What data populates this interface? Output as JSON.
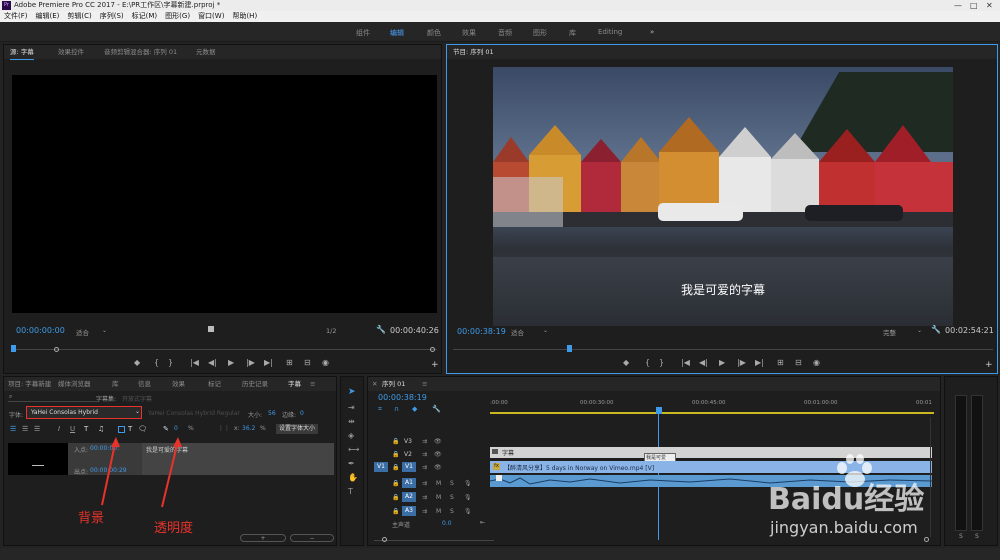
{
  "window": {
    "title": "Adobe Premiere Pro CC 2017 - E:\\PR工作区\\字幕新建.prproj *",
    "minimize": "—",
    "maximize": "□",
    "close": "✕",
    "app_badge": "Pr"
  },
  "menu": [
    "文件(F)",
    "编辑(E)",
    "剪辑(C)",
    "序列(S)",
    "标记(M)",
    "图形(G)",
    "窗口(W)",
    "帮助(H)"
  ],
  "workspaces": [
    "组件",
    "编辑",
    "颜色",
    "效果",
    "音频",
    "图形",
    "库",
    "Editing"
  ],
  "workspaces_more": "»",
  "source_panel": {
    "tabs": [
      "源: 字幕",
      "效果控件",
      "音频剪辑混合器: 序列 01",
      "元数据"
    ],
    "timecode_in": "00:00:00:00",
    "fit": "适合",
    "resolution": "1/2",
    "timecode_out": "00:00:40:26"
  },
  "program_panel": {
    "tab": "节目: 序列 01",
    "subtitle": "我是可爱的字幕",
    "timecode_in": "00:00:38:19",
    "fit": "适合",
    "quality": "完整",
    "timecode_out": "00:02:54:21"
  },
  "transport_source": [
    "◆",
    "{",
    "}",
    "|◀",
    "◀|",
    "▶",
    "|▶",
    "▶|",
    "⊞",
    "⊟",
    "◉"
  ],
  "transport_program": [
    "◆",
    "{",
    "}",
    "|◀",
    "◀|",
    "▶",
    "|▶",
    "▶|",
    "⊞",
    "⊟",
    "◉"
  ],
  "title_panel": {
    "tabs": [
      "项目: 字幕新建",
      "媒体浏览器",
      "库",
      "信息",
      "效果",
      "标记",
      "历史记录",
      "字幕"
    ],
    "search_placeholder": "",
    "title_name_label": "字幕集:",
    "title_name_value": "开放式字幕",
    "font_label": "字体:",
    "font_value": "YaHei Consolas Hybrid",
    "font_style": "YaHei Consolas Hybrid Regular",
    "size_label": "大小:",
    "size_value": "56",
    "edge_label": "边缘:",
    "edge_value": "0",
    "x_label": "x:",
    "x_value": "36.2",
    "x_unit": "%",
    "opacity_unit": "%",
    "set_font_size": "设置字体大小",
    "in_label": "入点:",
    "in_value": "00:00:00:",
    "out_label": "出点:",
    "out_value": "00:00:00:29",
    "caption_text": "我是可爱的字幕",
    "btn_plus": "+",
    "btn_minus": "−"
  },
  "annotations": {
    "background": "背景",
    "opacity": "透明度"
  },
  "timeline": {
    "tab": "序列 01",
    "timecode": "00:00:38:19",
    "ruler": [
      ":00:00",
      "00:00:30:00",
      "00:00:45:00",
      "00:01:00:00",
      "00:01"
    ],
    "tracks": [
      {
        "id": "V3",
        "target": ""
      },
      {
        "id": "V2",
        "target": ""
      },
      {
        "id": "V1",
        "target": "V1"
      },
      {
        "id": "A1",
        "target": ""
      },
      {
        "id": "A2",
        "target": ""
      },
      {
        "id": "A3",
        "target": ""
      }
    ],
    "master_label": "主声道",
    "master_value": "0.0",
    "caption_clip": "字幕",
    "caption_marker": "我是可爱",
    "video_clip": "【醉清风分享】5 days in Norway on Vimeo.mp4 [V]",
    "track_m": "M",
    "track_s": "S"
  },
  "meter": {
    "labels": [
      "S",
      "S"
    ]
  },
  "watermark": {
    "brand": "Baidu经验",
    "url": "jingyan.baidu.com"
  },
  "colors": {
    "accent": "#3d9be9",
    "annotation": "#e8332a",
    "video_clip": "#8ab4e8",
    "audio_clip": "#5a9ad0"
  }
}
